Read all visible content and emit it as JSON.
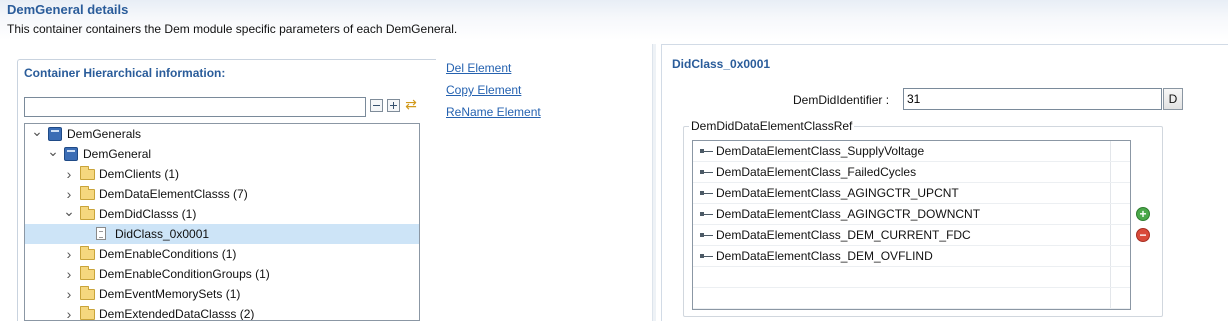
{
  "page": {
    "title": "DemGeneral details",
    "description": "This container containers the Dem module specific parameters of each DemGeneral."
  },
  "hierarchy": {
    "title": "Container Hierarchical information:",
    "filter_value": "",
    "tools": {
      "collapse_icon": "collapse-all-icon",
      "expand_icon": "expand-all-icon",
      "sync_icon": "link-sync-icon"
    },
    "tree": [
      {
        "label": "DemGenerals",
        "icon": "database-icon",
        "twisty": "expanded",
        "depth": 0
      },
      {
        "label": "DemGeneral",
        "icon": "database-icon",
        "twisty": "expanded",
        "depth": 1
      },
      {
        "label": "DemClients (1)",
        "icon": "folder-icon",
        "twisty": "collapsed",
        "depth": 2
      },
      {
        "label": "DemDataElementClasss (7)",
        "icon": "folder-icon",
        "twisty": "collapsed",
        "depth": 2
      },
      {
        "label": "DemDidClasss (1)",
        "icon": "folder-icon",
        "twisty": "expanded",
        "depth": 2
      },
      {
        "label": "DidClass_0x0001",
        "icon": "file-icon",
        "twisty": "none",
        "depth": 3,
        "selected": true
      },
      {
        "label": "DemEnableConditions (1)",
        "icon": "folder-icon",
        "twisty": "collapsed",
        "depth": 2
      },
      {
        "label": "DemEnableConditionGroups (1)",
        "icon": "folder-icon",
        "twisty": "collapsed",
        "depth": 2
      },
      {
        "label": "DemEventMemorySets (1)",
        "icon": "folder-icon",
        "twisty": "collapsed",
        "depth": 2
      },
      {
        "label": "DemExtendedDataClasss (2)",
        "icon": "folder-icon",
        "twisty": "collapsed",
        "depth": 2
      }
    ]
  },
  "actions": {
    "delete": "Del Element",
    "copy": "Copy Element",
    "rename": "ReName Element"
  },
  "detail": {
    "title": "DidClass_0x0001",
    "identifier_label": "DemDidIdentifier :",
    "identifier_value": "31",
    "identifier_button": "D",
    "refs_group_title": "DemDidDataElementClassRef",
    "refs": [
      "DemDataElementClass_SupplyVoltage",
      "DemDataElementClass_FailedCycles",
      "DemDataElementClass_AGINGCTR_UPCNT",
      "DemDataElementClass_AGINGCTR_DOWNCNT",
      "DemDataElementClass_DEM_CURRENT_FDC",
      "DemDataElementClass_DEM_OVFLIND"
    ],
    "add_button": "+",
    "remove_button": "−"
  },
  "colors": {
    "title_blue": "#2a5c9a",
    "link_blue": "#2562b0",
    "selection": "#cde4f7",
    "add_green": "#4aa84a",
    "remove_red": "#d94a3a"
  }
}
